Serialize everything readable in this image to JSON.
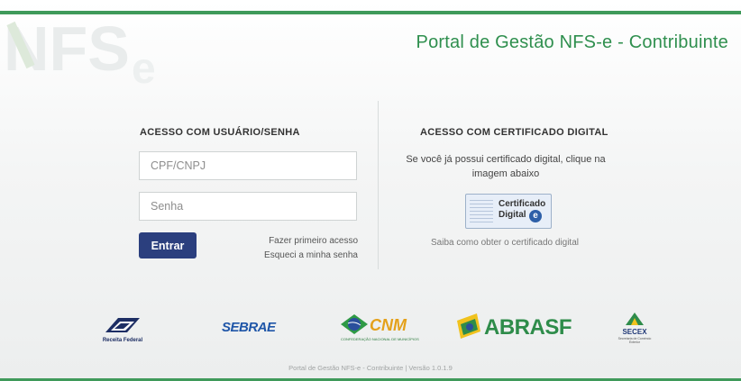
{
  "header": {
    "title": "Portal de Gestão NFS-e - Contribuinte",
    "watermark_logo": "NFSe",
    "accent_color": "#3f9a5a"
  },
  "login": {
    "heading": "ACESSO COM USUÁRIO/SENHA",
    "cpf_placeholder": "CPF/CNPJ",
    "password_placeholder": "Senha",
    "submit_label": "Entrar",
    "first_access_link": "Fazer primeiro acesso",
    "forgot_password_link": "Esqueci a minha senha",
    "button_color": "#2b3f7e"
  },
  "certificate": {
    "heading": "ACESSO COM CERTIFICADO DIGITAL",
    "description": "Se você já possui certificado digital, clique na imagem abaixo",
    "image_line1": "Certificado",
    "image_line2": "Digital",
    "image_badge": "e",
    "help_link": "Saiba como obter o certificado digital"
  },
  "partners": {
    "receita_label": "Receita Federal",
    "sebrae_label": "SEBRAE",
    "cnm_label": "CNM",
    "cnm_sub": "CONFEDERAÇÃO NACIONAL DE MUNICÍPIOS",
    "abrasf_label": "ABRASF",
    "secex_label": "SECEX",
    "secex_sub": "Secretaria de Comércio Exterior"
  },
  "footer": {
    "text": "Portal de Gestão NFS-e - Contribuinte | Versão 1.0.1.9"
  }
}
